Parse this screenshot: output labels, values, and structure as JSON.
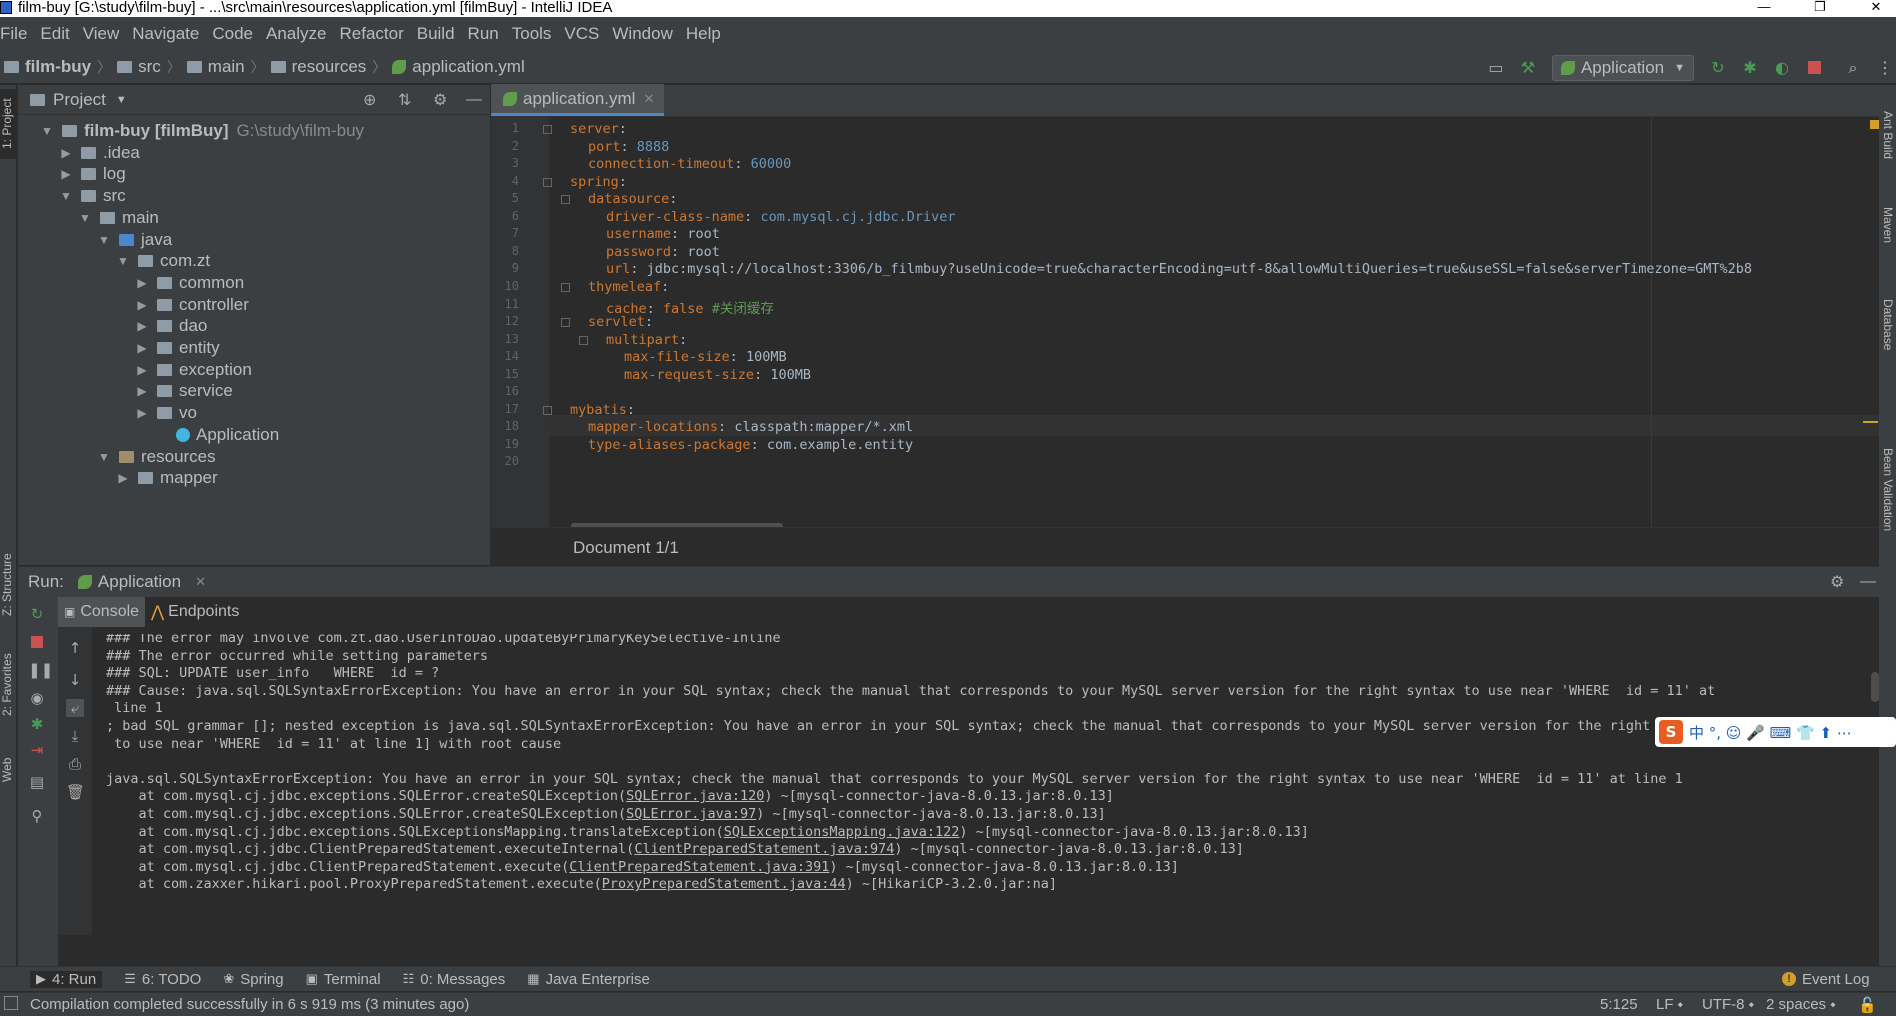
{
  "window": {
    "title": "film-buy [G:\\study\\film-buy] - ...\\src\\main\\resources\\application.yml [filmBuy] - IntelliJ IDEA",
    "minimize": "—",
    "restore": "❐",
    "close": "✕"
  },
  "menu": [
    "File",
    "Edit",
    "View",
    "Navigate",
    "Code",
    "Analyze",
    "Refactor",
    "Build",
    "Run",
    "Tools",
    "VCS",
    "Window",
    "Help"
  ],
  "breadcrumb": [
    "film-buy",
    "src",
    "main",
    "resources",
    "application.yml"
  ],
  "run_config": {
    "label": "Application",
    "arrow": "▼"
  },
  "project_panel": {
    "title": "Project",
    "dropdown": "▼",
    "tree": [
      {
        "label": "film-buy [filmBuy]",
        "path": "G:\\study\\film-buy",
        "indent": 0,
        "open": true,
        "type": "module"
      },
      {
        "label": ".idea",
        "indent": 1,
        "open": false,
        "type": "folder"
      },
      {
        "label": "log",
        "indent": 1,
        "open": false,
        "type": "folder"
      },
      {
        "label": "src",
        "indent": 1,
        "open": true,
        "type": "folder"
      },
      {
        "label": "main",
        "indent": 2,
        "open": true,
        "type": "folder"
      },
      {
        "label": "java",
        "indent": 3,
        "open": true,
        "type": "blue"
      },
      {
        "label": "com.zt",
        "indent": 4,
        "open": true,
        "type": "folder"
      },
      {
        "label": "common",
        "indent": 5,
        "open": false,
        "type": "folder"
      },
      {
        "label": "controller",
        "indent": 5,
        "open": false,
        "type": "folder"
      },
      {
        "label": "dao",
        "indent": 5,
        "open": false,
        "type": "folder"
      },
      {
        "label": "entity",
        "indent": 5,
        "open": false,
        "type": "folder"
      },
      {
        "label": "exception",
        "indent": 5,
        "open": false,
        "type": "folder"
      },
      {
        "label": "service",
        "indent": 5,
        "open": false,
        "type": "folder"
      },
      {
        "label": "vo",
        "indent": 5,
        "open": false,
        "type": "folder"
      },
      {
        "label": "Application",
        "indent": 6,
        "open": null,
        "type": "app"
      },
      {
        "label": "resources",
        "indent": 3,
        "open": true,
        "type": "res"
      },
      {
        "label": "mapper",
        "indent": 4,
        "open": false,
        "type": "folder"
      }
    ]
  },
  "editor": {
    "tab": "application.yml",
    "tab_close": "✕",
    "doc_status": "Document 1/1",
    "lines": [
      {
        "n": "1",
        "indent": 0,
        "key": "server",
        "val": "",
        "type": ""
      },
      {
        "n": "2",
        "indent": 1,
        "key": "port",
        "val": "8888",
        "type": "num"
      },
      {
        "n": "3",
        "indent": 1,
        "key": "connection-timeout",
        "val": "60000",
        "type": "num"
      },
      {
        "n": "4",
        "indent": 0,
        "key": "spring",
        "val": "",
        "type": ""
      },
      {
        "n": "5",
        "indent": 1,
        "key": "datasource",
        "val": "",
        "type": ""
      },
      {
        "n": "6",
        "indent": 2,
        "key": "driver-class-name",
        "val": "com.mysql.cj.jdbc.Driver",
        "type": "str"
      },
      {
        "n": "7",
        "indent": 2,
        "key": "username",
        "val": "root",
        "type": "plain"
      },
      {
        "n": "8",
        "indent": 2,
        "key": "password",
        "val": "root",
        "type": "plain"
      },
      {
        "n": "9",
        "indent": 2,
        "key": "url",
        "val": "jdbc:mysql://localhost:3306/b_filmbuy?useUnicode=true&characterEncoding=utf-8&allowMultiQueries=true&useSSL=false&serverTimezone=GMT%2b8",
        "type": "plain"
      },
      {
        "n": "10",
        "indent": 1,
        "key": "thymeleaf",
        "val": "",
        "type": ""
      },
      {
        "n": "11",
        "indent": 2,
        "key": "cache",
        "val": "false",
        "type": "bool",
        "comment": "#关闭缓存"
      },
      {
        "n": "12",
        "indent": 1,
        "key": "servlet",
        "val": "",
        "type": ""
      },
      {
        "n": "13",
        "indent": 2,
        "key": "multipart",
        "val": "",
        "type": ""
      },
      {
        "n": "14",
        "indent": 3,
        "key": "max-file-size",
        "val": "100MB",
        "type": "plain"
      },
      {
        "n": "15",
        "indent": 3,
        "key": "max-request-size",
        "val": "100MB",
        "type": "plain"
      },
      {
        "n": "16",
        "indent": 0,
        "key": "",
        "val": "",
        "type": ""
      },
      {
        "n": "17",
        "indent": 0,
        "key": "mybatis",
        "val": "",
        "type": ""
      },
      {
        "n": "18",
        "indent": 1,
        "key": "mapper-locations",
        "val": "classpath:mapper/*.xml",
        "type": "plain"
      },
      {
        "n": "19",
        "indent": 1,
        "key": "type-aliases-package",
        "val": "com.example.entity",
        "type": "plain"
      },
      {
        "n": "20",
        "indent": 0,
        "key": "",
        "val": "",
        "type": ""
      }
    ]
  },
  "run_panel": {
    "label": "Run:",
    "config": "Application",
    "tabs": [
      "Console",
      "Endpoints"
    ],
    "console": [
      "### The error may involve com.zt.dao.UserInfoDao.updateByPrimaryKeySelective-Inline",
      "### The error occurred while setting parameters",
      "### SQL: UPDATE user_info   WHERE  id = ?",
      "### Cause: java.sql.SQLSyntaxErrorException: You have an error in your SQL syntax; check the manual that corresponds to your MySQL server version for the right syntax to use near 'WHERE  id = 11' at",
      " line 1",
      "; bad SQL grammar []; nested exception is java.sql.SQLSyntaxErrorException: You have an error in your SQL syntax; check the manual that corresponds to your MySQL server version for the right syntax",
      " to use near 'WHERE  id = 11' at line 1] with root cause",
      "",
      "java.sql.SQLSyntaxErrorException: You have an error in your SQL syntax; check the manual that corresponds to your MySQL server version for the right syntax to use near 'WHERE  id = 11' at line 1"
    ],
    "stack": [
      {
        "pre": "    at com.mysql.cj.jdbc.exceptions.SQLError.createSQLException(",
        "link": "SQLError.java:120",
        "post": ") ~[mysql-connector-java-8.0.13.jar:8.0.13]"
      },
      {
        "pre": "    at com.mysql.cj.jdbc.exceptions.SQLError.createSQLException(",
        "link": "SQLError.java:97",
        "post": ") ~[mysql-connector-java-8.0.13.jar:8.0.13]"
      },
      {
        "pre": "    at com.mysql.cj.jdbc.exceptions.SQLExceptionsMapping.translateException(",
        "link": "SQLExceptionsMapping.java:122",
        "post": ") ~[mysql-connector-java-8.0.13.jar:8.0.13]"
      },
      {
        "pre": "    at com.mysql.cj.jdbc.ClientPreparedStatement.executeInternal(",
        "link": "ClientPreparedStatement.java:974",
        "post": ") ~[mysql-connector-java-8.0.13.jar:8.0.13]"
      },
      {
        "pre": "    at com.mysql.cj.jdbc.ClientPreparedStatement.execute(",
        "link": "ClientPreparedStatement.java:391",
        "post": ") ~[mysql-connector-java-8.0.13.jar:8.0.13]"
      },
      {
        "pre": "    at com.zaxxer.hikari.pool.ProxyPreparedStatement.execute(",
        "link": "ProxyPreparedStatement.java:44",
        "post": ") ~[HikariCP-3.2.0.jar:na]"
      }
    ]
  },
  "left_tools": [
    "1: Project",
    "Z: Structure",
    "2: Favorites",
    "Web"
  ],
  "right_tools": [
    "Ant Build",
    "Maven",
    "Database",
    "Bean Validation"
  ],
  "tool_windows": [
    {
      "label": "4: Run",
      "icon": "▶"
    },
    {
      "label": "6: TODO",
      "icon": "☰"
    },
    {
      "label": "Spring",
      "icon": "❀"
    },
    {
      "label": "Terminal",
      "icon": "▣"
    },
    {
      "label": "0: Messages",
      "icon": "☷"
    },
    {
      "label": "Java Enterprise",
      "icon": "▦"
    }
  ],
  "event_log": "Event Log",
  "status": {
    "message": "Compilation completed successfully in 6 s 919 ms (3 minutes ago)",
    "position": "5:125",
    "line_sep": "LF",
    "encoding": "UTF-8",
    "indent": "2 spaces"
  },
  "ime": {
    "logo": "S",
    "text": "中 °, ☺ 🎤 ⌨ 👕 ⬆ ⋯"
  },
  "colors": {
    "accent": "#4a88c7",
    "key": "#cc7832",
    "number": "#6897bb",
    "comment": "#629755",
    "stop": "#c75450",
    "run": "#499c54"
  }
}
